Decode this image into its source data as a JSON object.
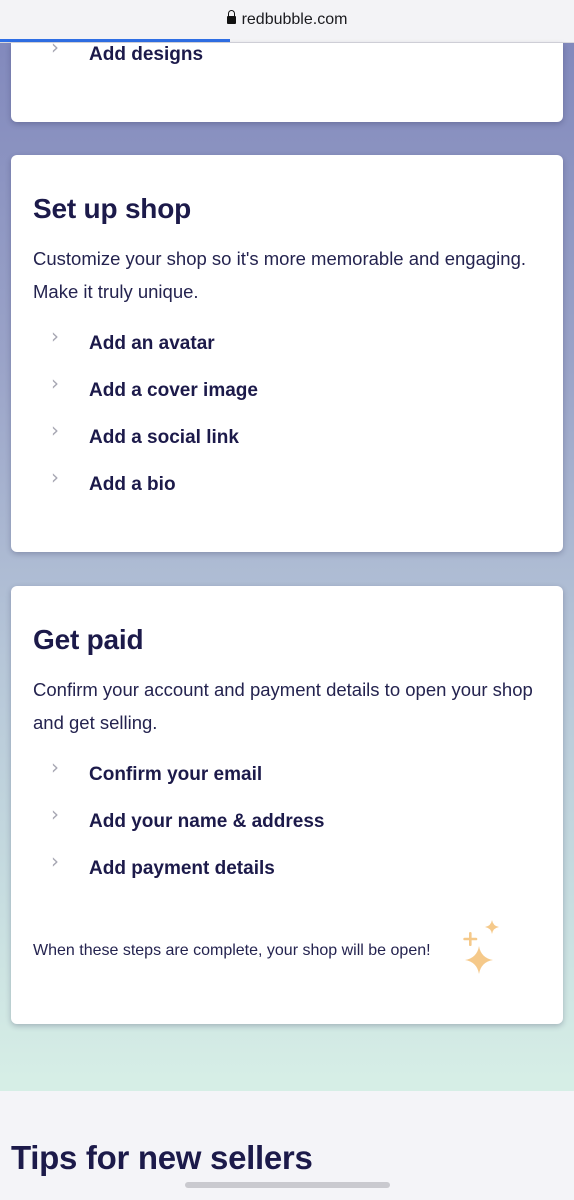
{
  "browser": {
    "url": "redbubble.com",
    "load_progress": 0.4
  },
  "add_designs_card": {
    "steps": [
      {
        "label": "Add designs"
      }
    ]
  },
  "set_up_shop": {
    "title": "Set up shop",
    "description": "Customize your shop so it's more memorable and engaging. Make it truly unique.",
    "steps": [
      {
        "label": "Add an avatar"
      },
      {
        "label": "Add a cover image"
      },
      {
        "label": "Add a social link"
      },
      {
        "label": "Add a bio"
      }
    ]
  },
  "get_paid": {
    "title": "Get paid",
    "description": "Confirm your account and payment details to open your shop and get selling.",
    "steps": [
      {
        "label": "Confirm your email"
      },
      {
        "label": "Add your name & address"
      },
      {
        "label": "Add payment details"
      }
    ],
    "footnote": "When these steps are complete, your shop will be open!"
  },
  "tips": {
    "title": "Tips for new sellers"
  },
  "icons": {
    "step_chevron": "chevron-right-icon",
    "sparkle": "sparkle-icon",
    "lock": "lock-icon"
  },
  "colors": {
    "heading": "#1c1a4a",
    "progress": "#2f6fe6",
    "sparkle": "#f5c98a"
  }
}
